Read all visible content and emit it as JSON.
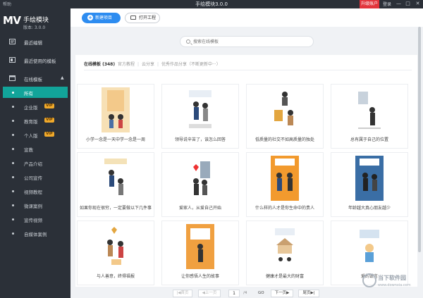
{
  "titlebar": {
    "help": "帮助",
    "title": "手绘模块3.0.0",
    "upgrade": "升级账户",
    "login": "登录",
    "minimize": "—",
    "maximize": "□",
    "close": "✕"
  },
  "brand": {
    "logo": "MV",
    "name": "手绘模块",
    "version": "版本: 3.0.0"
  },
  "sidebar": {
    "items": [
      {
        "label": "最近编辑",
        "icon": "recent-edit-icon"
      },
      {
        "label": "最近使用的模板",
        "icon": "recent-template-icon"
      },
      {
        "label": "在线模板",
        "icon": "online-template-icon"
      }
    ],
    "subitems": [
      {
        "label": "所有",
        "active": true
      },
      {
        "label": "企业版",
        "badge": "VIP"
      },
      {
        "label": "教育版",
        "badge": "VIP"
      },
      {
        "label": "个人版",
        "badge": "VIP"
      },
      {
        "label": "宣教"
      },
      {
        "label": "产品介绍"
      },
      {
        "label": "公司宣传"
      },
      {
        "label": "视频教程"
      },
      {
        "label": "微课案例"
      },
      {
        "label": "宣传视频"
      },
      {
        "label": "自媒体案例"
      }
    ]
  },
  "toolbar": {
    "new_label": "新建项目",
    "open_label": "打开工程"
  },
  "search": {
    "placeholder": "搜索在线模板"
  },
  "tabs": [
    {
      "label": "在线模板 (348)",
      "active": true
    },
    {
      "label": "官方教程"
    },
    {
      "label": "云分享"
    },
    {
      "label": "优秀作品分享（不断更新中···）"
    }
  ],
  "cards": [
    {
      "title": "小学一念是一天中学一念是一周"
    },
    {
      "title": "领导说辛苦了，该怎么回答"
    },
    {
      "title": "低质量的社交不如高质量的独处"
    },
    {
      "title": "总有属于自己的位置"
    },
    {
      "title": "如果你现在很穷，一定要做以下几件事"
    },
    {
      "title": "爱家人，从爱自己开始"
    },
    {
      "title": "什么样的人才是你生命中的贵人"
    },
    {
      "title": "年龄越大真心朋友越少"
    },
    {
      "title": "与人善意，终得福报"
    },
    {
      "title": "让你感悟人生的故事"
    },
    {
      "title": "健康才是最大的财富"
    },
    {
      "title": "爱的谎言"
    }
  ],
  "pager": {
    "first": "|◀首页",
    "prev": "◀上一页",
    "page": "1",
    "of": "/4",
    "go": "GO",
    "next": "下一页▶",
    "last": "尾页▶|"
  },
  "watermark": {
    "text": "当下软件园",
    "sub": "www.downxia.com"
  },
  "colors": {
    "sidebar_bg": "#2b3038",
    "active_teal": "#12a49a",
    "primary_blue": "#2d8cf0",
    "upgrade_red": "#e2353c",
    "vip_gold": "#f0a92b"
  }
}
